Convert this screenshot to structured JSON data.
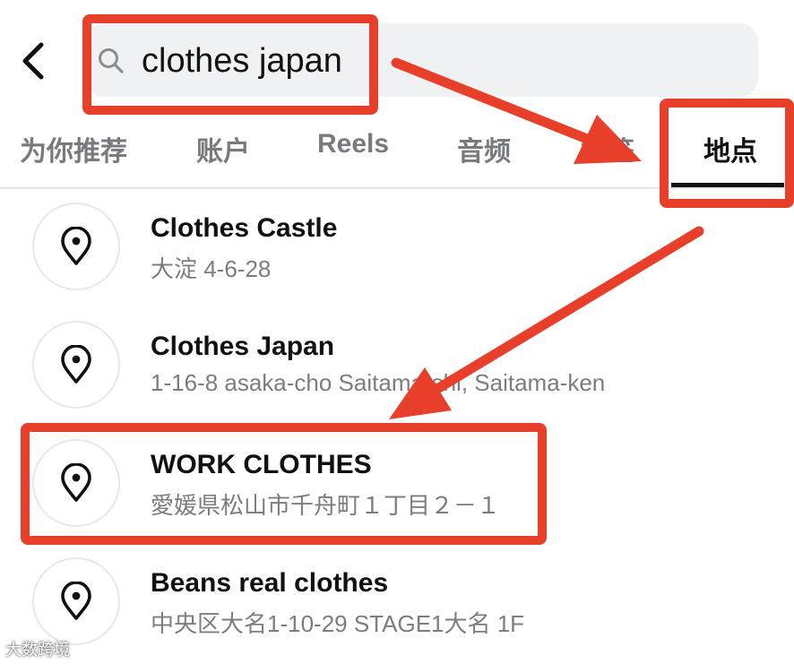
{
  "search": {
    "query": "clothes japan"
  },
  "tabs": [
    {
      "label": "为你推荐",
      "active": false
    },
    {
      "label": "账户",
      "active": false
    },
    {
      "label": "Reels",
      "active": false
    },
    {
      "label": "音频",
      "active": false
    },
    {
      "label": "标签",
      "active": false
    },
    {
      "label": "地点",
      "active": true
    }
  ],
  "results": [
    {
      "name": "Clothes Castle",
      "address": "大淀 4-6-28",
      "icon": "location-pin-icon"
    },
    {
      "name": "Clothes Japan",
      "address": "1-16-8 asaka-cho Saitama-shi, Saitama-ken",
      "icon": "location-pin-icon"
    },
    {
      "name": "WORK CLOTHES",
      "address": "愛媛県松山市千舟町１丁目２－１",
      "icon": "location-pin-icon"
    },
    {
      "name": "Beans real clothes",
      "address": "中央区大名1-10-29 STAGE1大名 1F",
      "icon": "location-pin-icon"
    }
  ],
  "annotation": {
    "color": "#e83f2a"
  },
  "watermark": {
    "text": "大数跨境"
  }
}
